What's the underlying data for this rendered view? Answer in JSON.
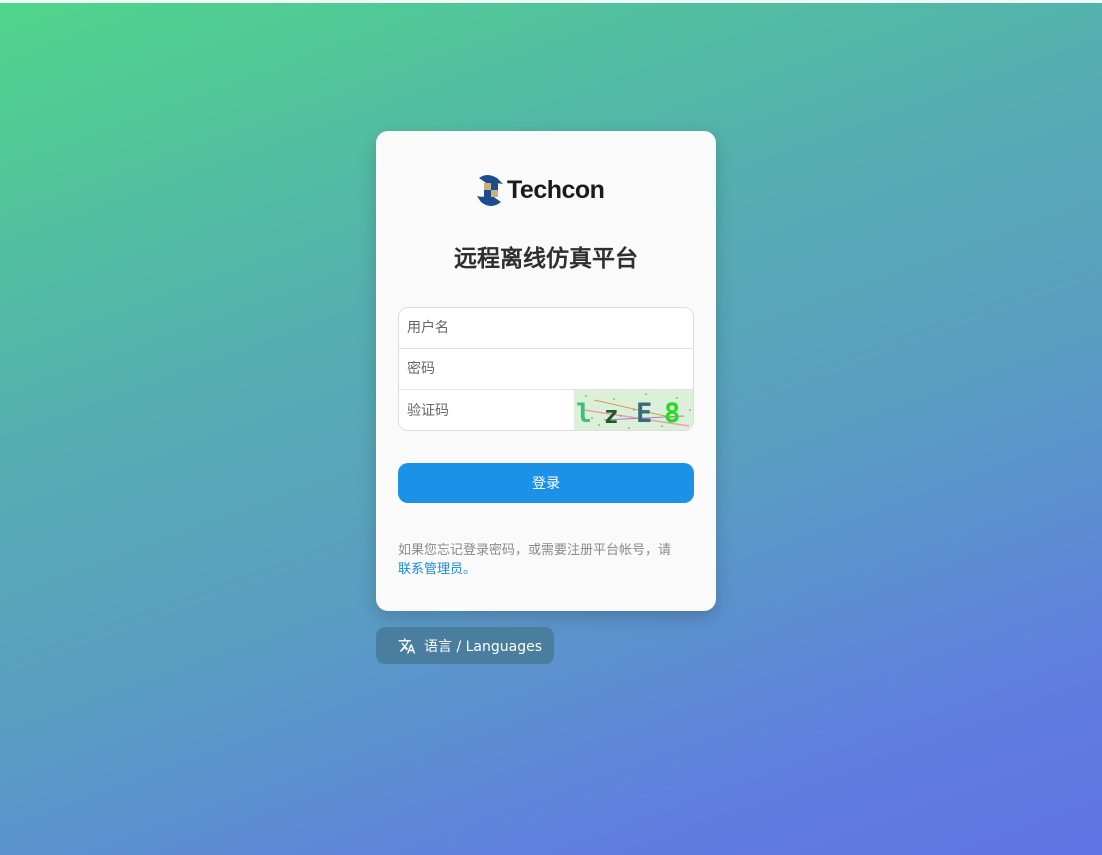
{
  "brand": {
    "logo_text": "Techcon",
    "logo_icon": "techcon-logo-icon"
  },
  "page": {
    "title": "远程离线仿真平台"
  },
  "form": {
    "username_placeholder": "用户名",
    "password_placeholder": "密码",
    "captcha_placeholder": "验证码",
    "captcha_chars": [
      "l",
      "z",
      "E",
      "8"
    ],
    "login_label": "登录"
  },
  "help": {
    "text": "如果您忘记登录密码，或需要注册平台帐号，请",
    "link_text": "联系管理员。"
  },
  "language": {
    "label": "语言 / Languages",
    "icon": "translate-icon"
  },
  "colors": {
    "primary": "#1c91e8",
    "link": "#1a8ae0",
    "gradient_start": "#4fd68a",
    "gradient_end": "#6172e4",
    "lang_button": "#4a7e9f"
  }
}
